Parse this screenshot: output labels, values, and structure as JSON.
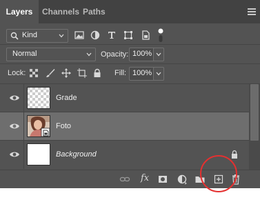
{
  "tabs": [
    {
      "label": "Layers",
      "active": true
    },
    {
      "label": "Channels",
      "active": false
    },
    {
      "label": "Paths",
      "active": false
    }
  ],
  "filter": {
    "kind_label": "Kind",
    "icons": [
      "image-filter-icon",
      "adjustment-filter-icon",
      "type-filter-icon",
      "shape-filter-icon",
      "smart-object-filter-icon",
      "filter-toggle-icon"
    ]
  },
  "blend": {
    "mode": "Normal",
    "opacity_label": "Opacity:",
    "opacity_value": "100%",
    "fill_label": "Fill:",
    "fill_value": "100%"
  },
  "lock": {
    "label": "Lock:",
    "icons": [
      "lock-transparent-pixels-icon",
      "lock-image-pixels-icon",
      "lock-position-icon",
      "lock-artboard-icon",
      "lock-all-icon"
    ]
  },
  "layers": [
    {
      "name": "Grade",
      "visible": true,
      "selected": false,
      "italic": false,
      "locked": false,
      "thumb": "transparent"
    },
    {
      "name": "Foto",
      "visible": true,
      "selected": true,
      "italic": false,
      "locked": false,
      "thumb": "photo-smart-object"
    },
    {
      "name": "Background",
      "visible": true,
      "selected": false,
      "italic": true,
      "locked": true,
      "thumb": "white"
    }
  ],
  "bottom_toolbar": {
    "fx_label": "fx",
    "icons": [
      "link-layers-icon",
      "layer-style-icon",
      "add-mask-icon",
      "adjustment-layer-icon",
      "new-group-icon",
      "new-layer-icon",
      "delete-layer-icon"
    ],
    "highlighted": "new-layer-icon"
  },
  "colors": {
    "panel_bg": "#535353",
    "tabbar_bg": "#424242",
    "selected_row": "#6e6e6e",
    "highlight_circle": "#e53030"
  }
}
